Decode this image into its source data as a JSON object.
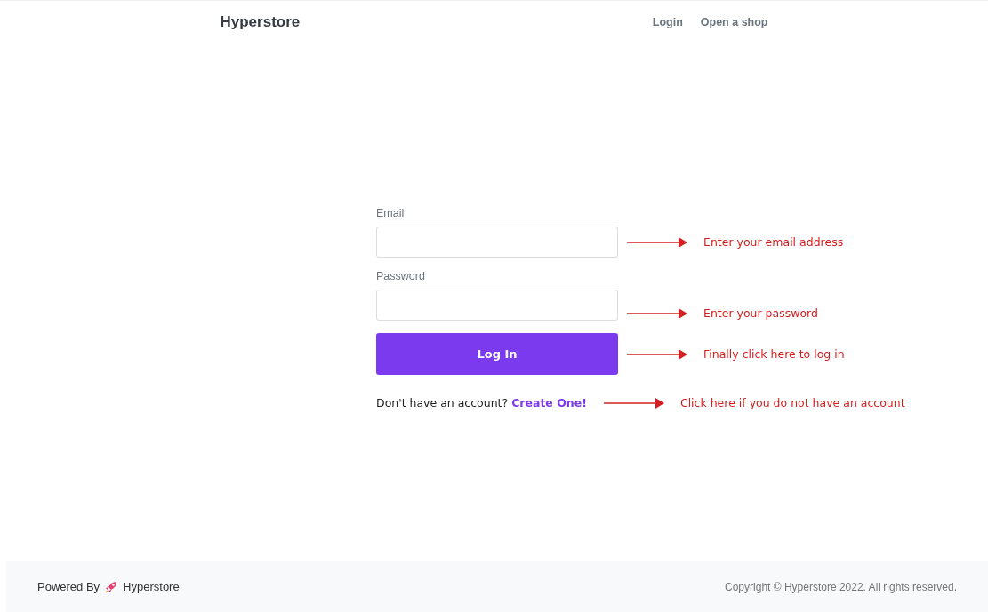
{
  "header": {
    "brand": "Hyperstore",
    "nav": [
      "Login",
      "Open a shop"
    ]
  },
  "form": {
    "email_label": "Email",
    "password_label": "Password",
    "submit": "Log In",
    "signup_prompt": "Don't have an account?",
    "signup_link": "Create One!"
  },
  "annotations": [
    "Enter your email address",
    "Enter your password",
    "Finally click here to log in",
    "Click here if you do not have an account"
  ],
  "footer": {
    "powered_by": "Powered By",
    "brand": "Hyperstore",
    "copyright": "Copyright © Hyperstore 2022. All rights reserved."
  }
}
